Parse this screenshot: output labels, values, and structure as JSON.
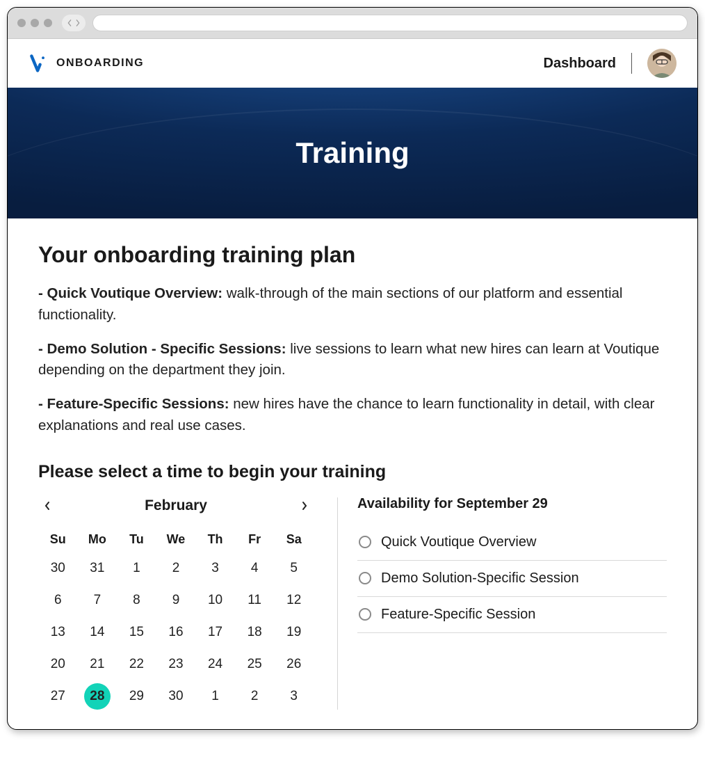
{
  "header": {
    "brand": "ONBOARDING",
    "nav_dashboard": "Dashboard"
  },
  "hero": {
    "title": "Training"
  },
  "plan": {
    "heading": "Your onboarding training plan",
    "items": [
      {
        "label": "- Quick Voutique Overview:",
        "desc": " walk-through of the main sections of our platform and essential functionality."
      },
      {
        "label": "- Demo Solution - Specific Sessions:",
        "desc": " live sessions to learn what new hires can learn at Voutique depending on the department they join."
      },
      {
        "label": "- Feature-Specific Sessions:",
        "desc": " new hires have the chance to learn functionality in detail, with clear explanations and real use cases."
      }
    ]
  },
  "schedule": {
    "heading": "Please select a time to begin your training"
  },
  "calendar": {
    "month": "February",
    "weekdays": [
      "Su",
      "Mo",
      "Tu",
      "We",
      "Th",
      "Fr",
      "Sa"
    ],
    "selected": "28",
    "rows": [
      [
        "30",
        "31",
        "1",
        "2",
        "3",
        "4",
        "5"
      ],
      [
        "6",
        "7",
        "8",
        "9",
        "10",
        "11",
        "12"
      ],
      [
        "13",
        "14",
        "15",
        "16",
        "17",
        "18",
        "19"
      ],
      [
        "20",
        "21",
        "22",
        "23",
        "24",
        "25",
        "26"
      ],
      [
        "27",
        "28",
        "29",
        "30",
        "1",
        "2",
        "3"
      ]
    ]
  },
  "availability": {
    "title": "Availability for September 29",
    "options": [
      "Quick Voutique Overview",
      "Demo Solution-Specific Session",
      "Feature-Specific Session"
    ]
  },
  "colors": {
    "accent": "#12d3b8",
    "hero_bg": "#0c2a57",
    "brand_blue": "#0b66c3"
  }
}
